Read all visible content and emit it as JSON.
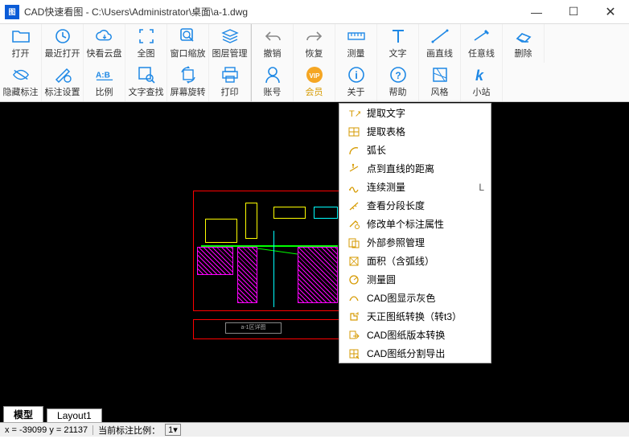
{
  "titlebar": {
    "app_icon_text": "图",
    "title": "CAD快速看图 - C:\\Users\\Administrator\\桌面\\a-1.dwg"
  },
  "ribbon_row1": [
    {
      "id": "open",
      "label": "打开"
    },
    {
      "id": "recent",
      "label": "最近打开"
    },
    {
      "id": "cloud",
      "label": "快看云盘"
    },
    {
      "id": "full",
      "label": "全图"
    },
    {
      "id": "zoomwin",
      "label": "窗口缩放"
    },
    {
      "id": "layers",
      "label": "图层管理"
    },
    {
      "id": "undo",
      "label": "撤销"
    },
    {
      "id": "redo",
      "label": "恢复"
    },
    {
      "id": "measure",
      "label": "测量"
    },
    {
      "id": "text",
      "label": "文字"
    },
    {
      "id": "line",
      "label": "画直线"
    },
    {
      "id": "freeline",
      "label": "任意线"
    },
    {
      "id": "delete",
      "label": "删除"
    }
  ],
  "ribbon_row2": [
    {
      "id": "hideann",
      "label": "隐藏标注"
    },
    {
      "id": "annset",
      "label": "标注设置"
    },
    {
      "id": "scale",
      "label": "比例"
    },
    {
      "id": "findtext",
      "label": "文字查找"
    },
    {
      "id": "rotate",
      "label": "屏幕旋转"
    },
    {
      "id": "print",
      "label": "打印"
    },
    {
      "id": "account",
      "label": "账号"
    },
    {
      "id": "vip",
      "label": "会员",
      "vip": true
    },
    {
      "id": "about",
      "label": "关于"
    },
    {
      "id": "help",
      "label": "帮助"
    },
    {
      "id": "style",
      "label": "风格"
    },
    {
      "id": "kstation",
      "label": "小站"
    }
  ],
  "dropdown": [
    {
      "label": "提取文字"
    },
    {
      "label": "提取表格"
    },
    {
      "label": "弧长"
    },
    {
      "label": "点到直线的距离"
    },
    {
      "label": "连续测量",
      "shortcut": "L"
    },
    {
      "label": "查看分段长度"
    },
    {
      "label": "修改单个标注属性"
    },
    {
      "label": "外部参照管理"
    },
    {
      "label": "面积（含弧线）"
    },
    {
      "label": "测量圆"
    },
    {
      "label": "CAD图显示灰色"
    },
    {
      "label": "天正图纸转换（转t3）"
    },
    {
      "label": "CAD图纸版本转换"
    },
    {
      "label": "CAD图纸分割导出"
    }
  ],
  "tabs": {
    "model": "模型",
    "layout": "Layout1"
  },
  "status": {
    "coords": "x = -39099 y = 21137",
    "scale_label": "当前标注比例：",
    "scale_value": "1"
  }
}
